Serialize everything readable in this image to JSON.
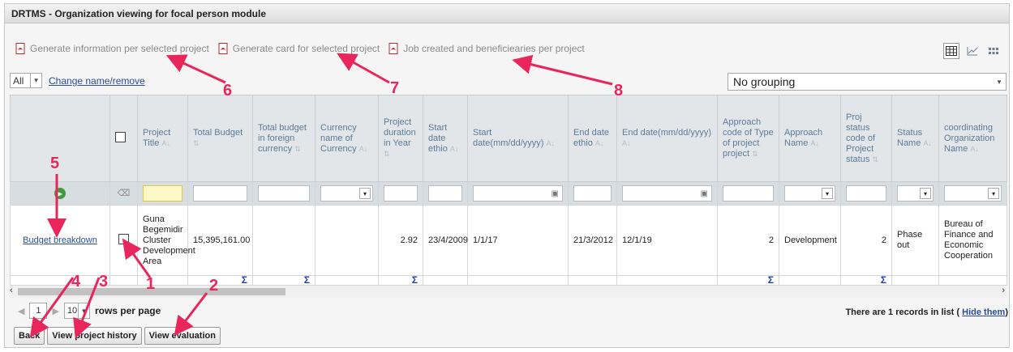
{
  "window": {
    "title": "DRTMS - Organization viewing for focal person module"
  },
  "links": [
    {
      "label": "Generate information per selected project",
      "icon": "pdf-icon"
    },
    {
      "label": "Generate card for selected project",
      "icon": "pdf-icon"
    },
    {
      "label": "Job created and beneficiearies per project",
      "icon": "pdf-icon"
    }
  ],
  "view_icons": [
    "grid-view-icon",
    "chart-view-icon",
    "tile-view-icon"
  ],
  "filter": {
    "all_value": "All",
    "change_link": "Change name/remove"
  },
  "grouping": {
    "value": "No grouping"
  },
  "columns": [
    {
      "label": ""
    },
    {
      "label": ""
    },
    {
      "label": "Project Title"
    },
    {
      "label": "Total Budget"
    },
    {
      "label": "Total budget in foreign currency"
    },
    {
      "label": "Currency name of Currency"
    },
    {
      "label": "Project duration in Year"
    },
    {
      "label": "Start date ethio"
    },
    {
      "label": "Start date(mm/dd/yyyy)"
    },
    {
      "label": "End date ethio"
    },
    {
      "label": "End date(mm/dd/yyyy)"
    },
    {
      "label": "Approach code of Type of project project"
    },
    {
      "label": "Approach Name"
    },
    {
      "label": "Proj status code of Project status"
    },
    {
      "label": "Status Name"
    },
    {
      "label": "coordinating Organization Name"
    }
  ],
  "row": {
    "action_link": "Budget breakdown",
    "project_title": "Guna Begemidir Cluster Development Area",
    "total_budget": "15,395,161.00",
    "foreign_budget": "",
    "currency": "",
    "duration": "2.92",
    "start_ethio": "23/4/2009",
    "start_date": "1/1/17",
    "end_ethio": "21/3/2012",
    "end_date": "12/1/19",
    "approach_code": "2",
    "approach_name": "Development",
    "status_code": "2",
    "status_name": "Phase out",
    "org_name": "Bureau of Finance and Economic Cooperation"
  },
  "sum_symbol": "Σ",
  "pager": {
    "page": "1",
    "rows": "10",
    "rows_label": "rows per page"
  },
  "records": {
    "text": "There are 1 records in list (",
    "hide_link": "Hide them",
    "close": ")"
  },
  "buttons": {
    "back": "Back",
    "history": "View project history",
    "evaluation": "View evaluation"
  },
  "annotations": [
    "1",
    "2",
    "3",
    "4",
    "5",
    "6",
    "7",
    "8"
  ],
  "colors": {
    "annotation": "#e8265c",
    "link": "#2a4d9b",
    "header_text": "#5b7a99"
  }
}
